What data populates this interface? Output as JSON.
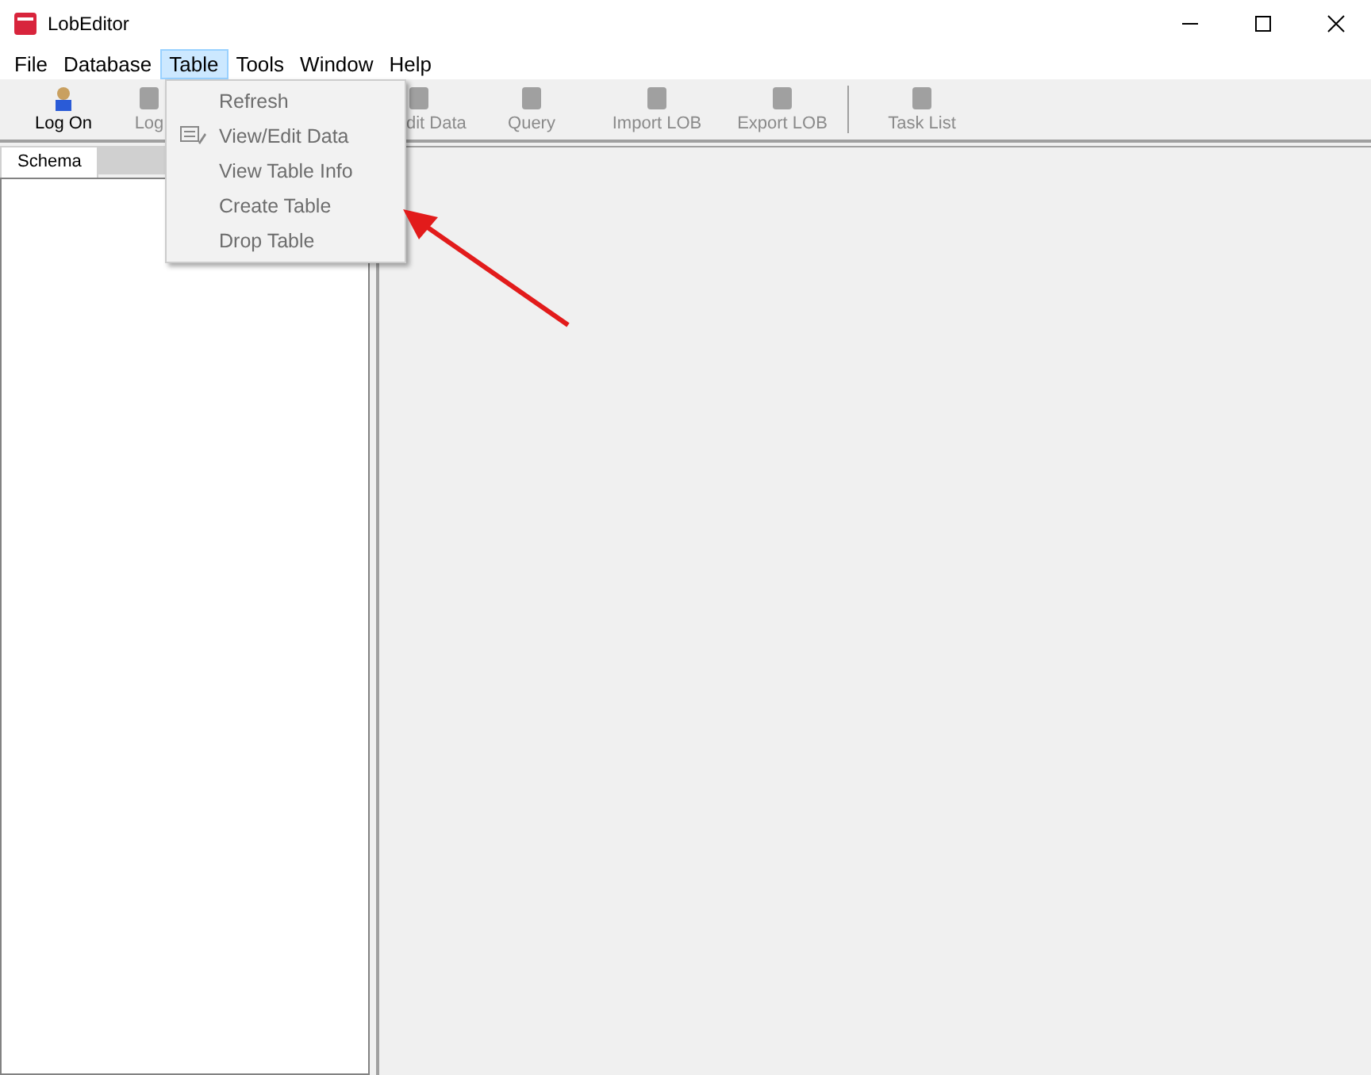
{
  "window": {
    "title": "LobEditor"
  },
  "menu_bar": [
    {
      "label": "File",
      "selected": false
    },
    {
      "label": "Database",
      "selected": false
    },
    {
      "label": "Table",
      "selected": true
    },
    {
      "label": "Tools",
      "selected": false
    },
    {
      "label": "Window",
      "selected": false
    },
    {
      "label": "Help",
      "selected": false
    }
  ],
  "toolbar": [
    {
      "kind": "button",
      "label": "Log On",
      "disabled": false
    },
    {
      "kind": "button",
      "label": "Log",
      "disabled": true
    },
    {
      "kind": "button",
      "label": "dit Data",
      "disabled": true
    },
    {
      "kind": "button",
      "label": "Query",
      "disabled": true
    },
    {
      "kind": "button",
      "label": "Import LOB",
      "disabled": true
    },
    {
      "kind": "button",
      "label": "Export LOB",
      "disabled": true
    },
    {
      "kind": "separator"
    },
    {
      "kind": "button",
      "label": "Task List",
      "disabled": true
    }
  ],
  "left_panel": {
    "tabs": [
      {
        "label": "Schema",
        "selected": true
      }
    ]
  },
  "dropdown_menu": [
    {
      "label": "Refresh",
      "disabled": true,
      "has_icon": false
    },
    {
      "label": "View/Edit Data",
      "disabled": true,
      "has_icon": true
    },
    {
      "label": "View Table Info",
      "disabled": true,
      "has_icon": false
    },
    {
      "label": "Create Table",
      "disabled": true,
      "has_icon": false
    },
    {
      "label": "Drop Table",
      "disabled": true,
      "has_icon": false
    }
  ],
  "annotation": {
    "kind": "arrow"
  }
}
